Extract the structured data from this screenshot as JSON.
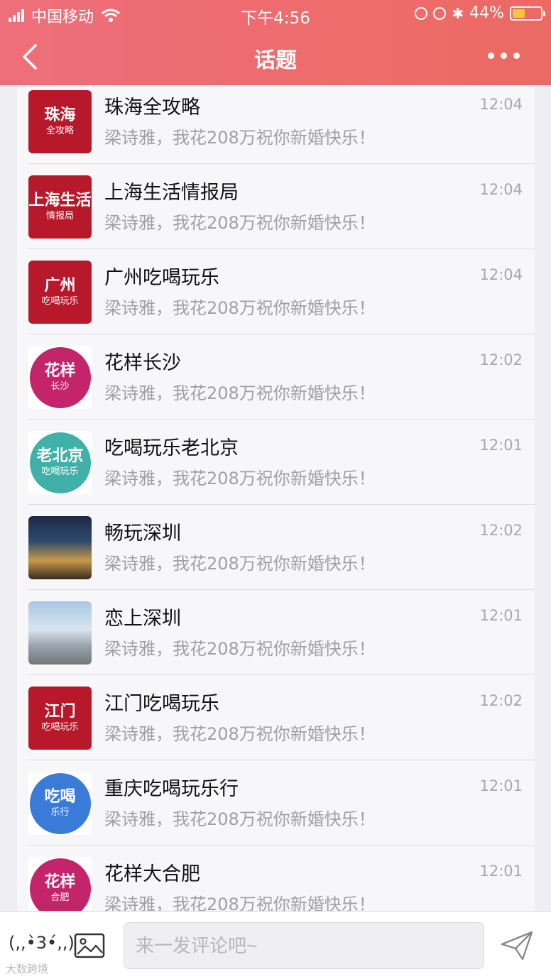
{
  "status_bar": {
    "carrier": "中国移动",
    "time": "下午4:56",
    "battery": "44%",
    "battery_level": 0.44
  },
  "nav": {
    "title": "话题",
    "back_icon": "chevron-left-icon",
    "more_icon": "more-dots-icon"
  },
  "topics": [
    {
      "name": "珠海全攻略",
      "message": "梁诗雅，我花208万祝你新婚快乐！",
      "time": "12:04",
      "avatar_text": "珠海",
      "avatar_sub": "全攻略",
      "avatar_color": "#b8192a",
      "avatar_shape": "square"
    },
    {
      "name": "上海生活情报局",
      "message": "梁诗雅，我花208万祝你新婚快乐！",
      "time": "12:04",
      "avatar_text": "上海生活",
      "avatar_sub": "情报局",
      "avatar_color": "#b8192a",
      "avatar_shape": "square"
    },
    {
      "name": "广州吃喝玩乐",
      "message": "梁诗雅，我花208万祝你新婚快乐！",
      "time": "12:04",
      "avatar_text": "广州",
      "avatar_sub": "吃喝玩乐",
      "avatar_color": "#b8192a",
      "avatar_shape": "square"
    },
    {
      "name": "花样长沙",
      "message": "梁诗雅，我花208万祝你新婚快乐！",
      "time": "12:02",
      "avatar_text": "花样",
      "avatar_sub": "长沙",
      "avatar_color": "#c4246a",
      "avatar_shape": "circle"
    },
    {
      "name": "吃喝玩乐老北京",
      "message": "梁诗雅，我花208万祝你新婚快乐！",
      "time": "12:01",
      "avatar_text": "老北京",
      "avatar_sub": "吃喝玩乐",
      "avatar_color": "#3fb1a8",
      "avatar_shape": "circle"
    },
    {
      "name": "畅玩深圳",
      "message": "梁诗雅，我花208万祝你新婚快乐！",
      "time": "12:02",
      "avatar_text": "",
      "avatar_sub": "",
      "avatar_color": "#24344f",
      "avatar_shape": "photo-night"
    },
    {
      "name": "恋上深圳",
      "message": "梁诗雅，我花208万祝你新婚快乐！",
      "time": "12:01",
      "avatar_text": "",
      "avatar_sub": "",
      "avatar_color": "#8fb6d6",
      "avatar_shape": "photo-day"
    },
    {
      "name": "江门吃喝玩乐",
      "message": "梁诗雅，我花208万祝你新婚快乐！",
      "time": "12:02",
      "avatar_text": "江门",
      "avatar_sub": "吃喝玩乐",
      "avatar_color": "#b8192a",
      "avatar_shape": "square"
    },
    {
      "name": "重庆吃喝玩乐行",
      "message": "梁诗雅，我花208万祝你新婚快乐！",
      "time": "12:01",
      "avatar_text": "吃喝",
      "avatar_sub": "乐行",
      "avatar_color": "#3a7ad8",
      "avatar_shape": "circle"
    },
    {
      "name": "花样大合肥",
      "message": "梁诗雅，我花208万祝你新婚快乐！",
      "time": "12:01",
      "avatar_text": "花样",
      "avatar_sub": "合肥",
      "avatar_color": "#c4246a",
      "avatar_shape": "circle"
    }
  ],
  "composer": {
    "emoji_label": "(,,•̀3•́,,)",
    "placeholder": "来一发评论吧~",
    "image_icon": "image-icon",
    "send_icon": "send-icon"
  },
  "watermark": "大数跨境"
}
